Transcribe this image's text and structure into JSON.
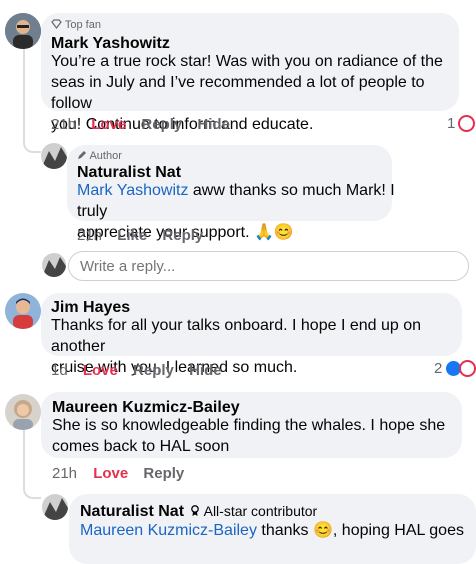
{
  "comments": [
    {
      "badge": "Top fan",
      "author": "Mark Yashowitz",
      "lines": [
        "You’re a true rock star!  Was with you on radiance of the",
        "seas in July and I’ve recommended a lot of people to follow",
        "you!  Continue to inform and educate."
      ],
      "time": "21h",
      "actions": [
        "Love",
        "Reply",
        "Hide"
      ],
      "reaction_count": "1"
    },
    {
      "badge": "Author",
      "author": "Naturalist Nat",
      "mention": "Mark Yashowitz",
      "lines": [
        " aww thanks so much Mark! I truly",
        "appreciate your support. 🙏😊"
      ],
      "time": "21h",
      "actions": [
        "Like",
        "Reply"
      ]
    },
    {
      "author": "Jim Hayes",
      "lines": [
        "Thanks for all your talks onboard. I hope I end up on another",
        "cruise with you. I learned so much."
      ],
      "time": "1d",
      "actions": [
        "Love",
        "Reply",
        "Hide"
      ],
      "reaction_count": "2"
    },
    {
      "author": "Maureen Kuzmicz-Bailey",
      "lines": [
        "She is so  knowledgeable finding the whales.  I hope she",
        "comes back to HAL soon"
      ],
      "time": "21h",
      "actions": [
        "Love",
        "Reply"
      ]
    },
    {
      "author": "Naturalist Nat",
      "badge": "All-star contributor",
      "mention": "Maureen Kuzmicz-Bailey",
      "line_rest": " thanks 😊, hoping HAL goes"
    }
  ],
  "reply_box": {
    "placeholder": "Write a reply..."
  },
  "colors": {
    "love": "#e4304f",
    "mention": "#1a65c5",
    "bubble": "#f0f2f5",
    "meta": "#65676b"
  },
  "icons": [
    "top-fan-badge-icon",
    "author-pencil-icon",
    "all-star-badge-icon",
    "heart-reaction-icon",
    "like-reaction-icon"
  ]
}
